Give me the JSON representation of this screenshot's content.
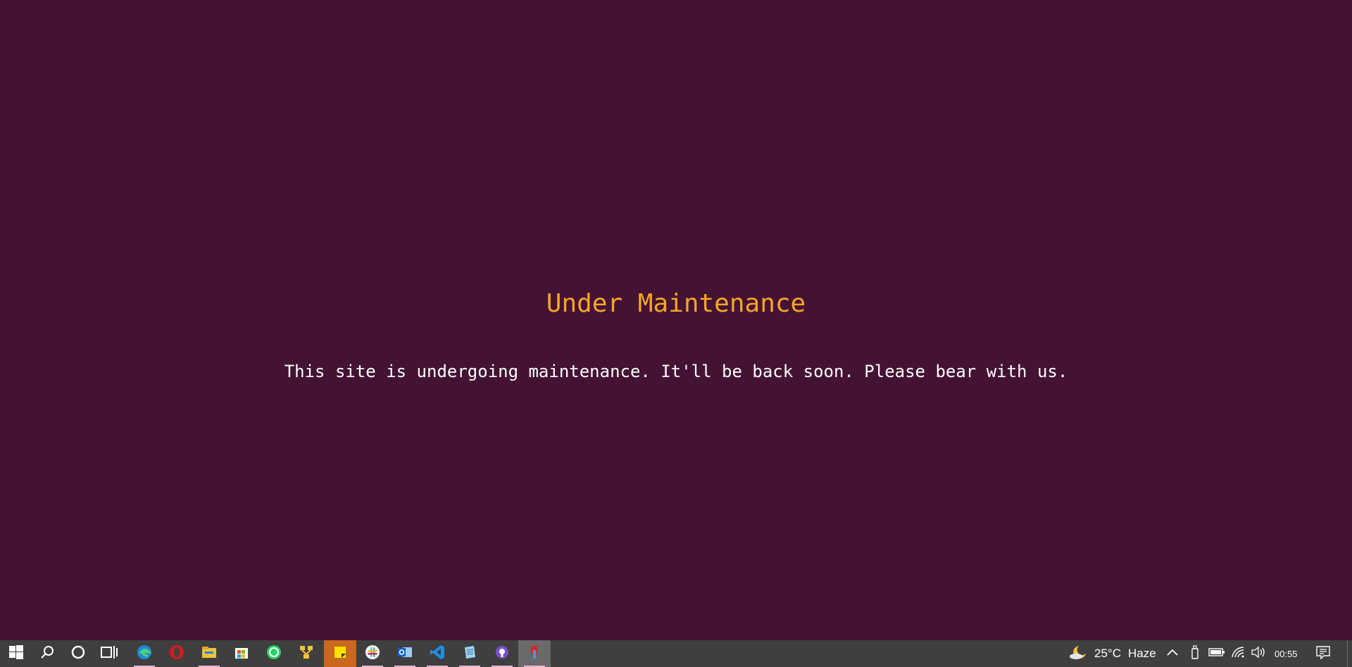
{
  "main": {
    "title": "Under Maintenance",
    "message": "This site is undergoing maintenance. It'll be back soon. Please bear with us."
  },
  "colors": {
    "background": "#441334",
    "title": "#f5a623",
    "message": "#ffffff",
    "taskbar": "#3f3f3f"
  },
  "taskbar": {
    "icons": [
      "windows-start-icon",
      "search-icon",
      "cortana-icon",
      "task-view-icon",
      "edge-icon",
      "opera-icon",
      "file-explorer-icon",
      "store-icon",
      "whatsapp-icon",
      "network-app-icon",
      "sticky-notes-icon",
      "slack-icon",
      "outlook-icon",
      "vscode-icon",
      "notepad-icon",
      "github-icon",
      "app-icon"
    ],
    "weather": {
      "icon": "moon-cloud-icon",
      "temperature": "25°C",
      "condition": "Haze"
    },
    "clock": "00:55"
  }
}
